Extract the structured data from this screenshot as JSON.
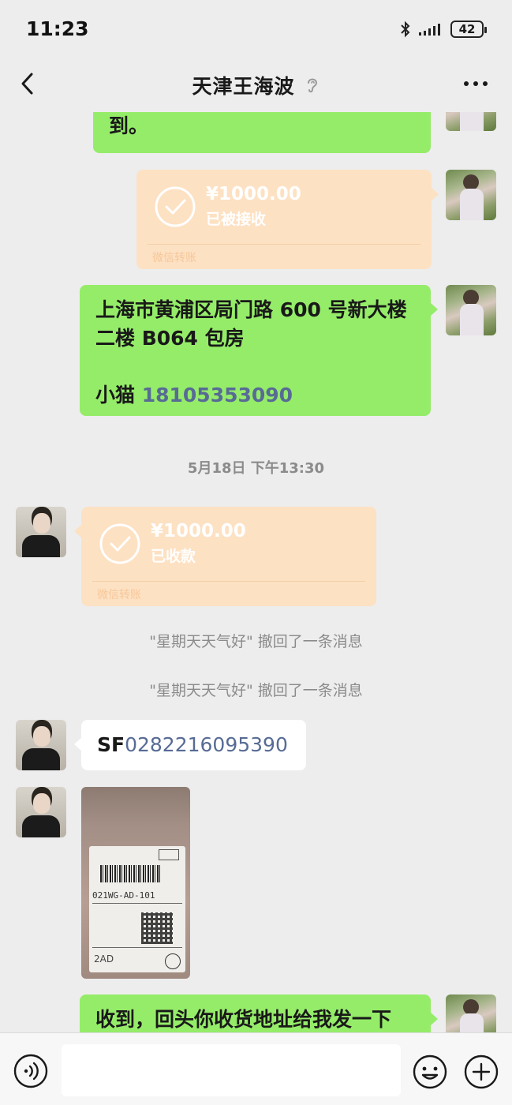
{
  "status_bar": {
    "time": "11:23",
    "battery": "42"
  },
  "header": {
    "title": "天津王海波"
  },
  "messages": {
    "partial_top_text": "到。",
    "transfer1": {
      "amount": "¥1000.00",
      "status": "已被接收",
      "source": "微信转账"
    },
    "address": {
      "line1": "上海市黄浦区局门路 600 号新大楼",
      "line2": "二楼 B064 包房",
      "name": "小猫 ",
      "phone": "18105353090"
    },
    "timestamp": "5月18日 下午13:30",
    "transfer2": {
      "amount": "¥1000.00",
      "status": "已收款",
      "source": "微信转账"
    },
    "recall1": "\"星期天天气好\" 撤回了一条消息",
    "recall2": "\"星期天天气好\" 撤回了一条消息",
    "tracking": {
      "prefix": "SF",
      "number": "0282216095390"
    },
    "image_label": {
      "code": "021WG-AD-101",
      "tag": "2AD"
    },
    "last_text": "收到，回头你收货地址给我发一下"
  },
  "input_bar": {
    "placeholder": ""
  },
  "colors": {
    "green_bubble": "#95ec69",
    "transfer_card": "#fde1c3",
    "link": "#576b95",
    "background": "#ededed"
  }
}
